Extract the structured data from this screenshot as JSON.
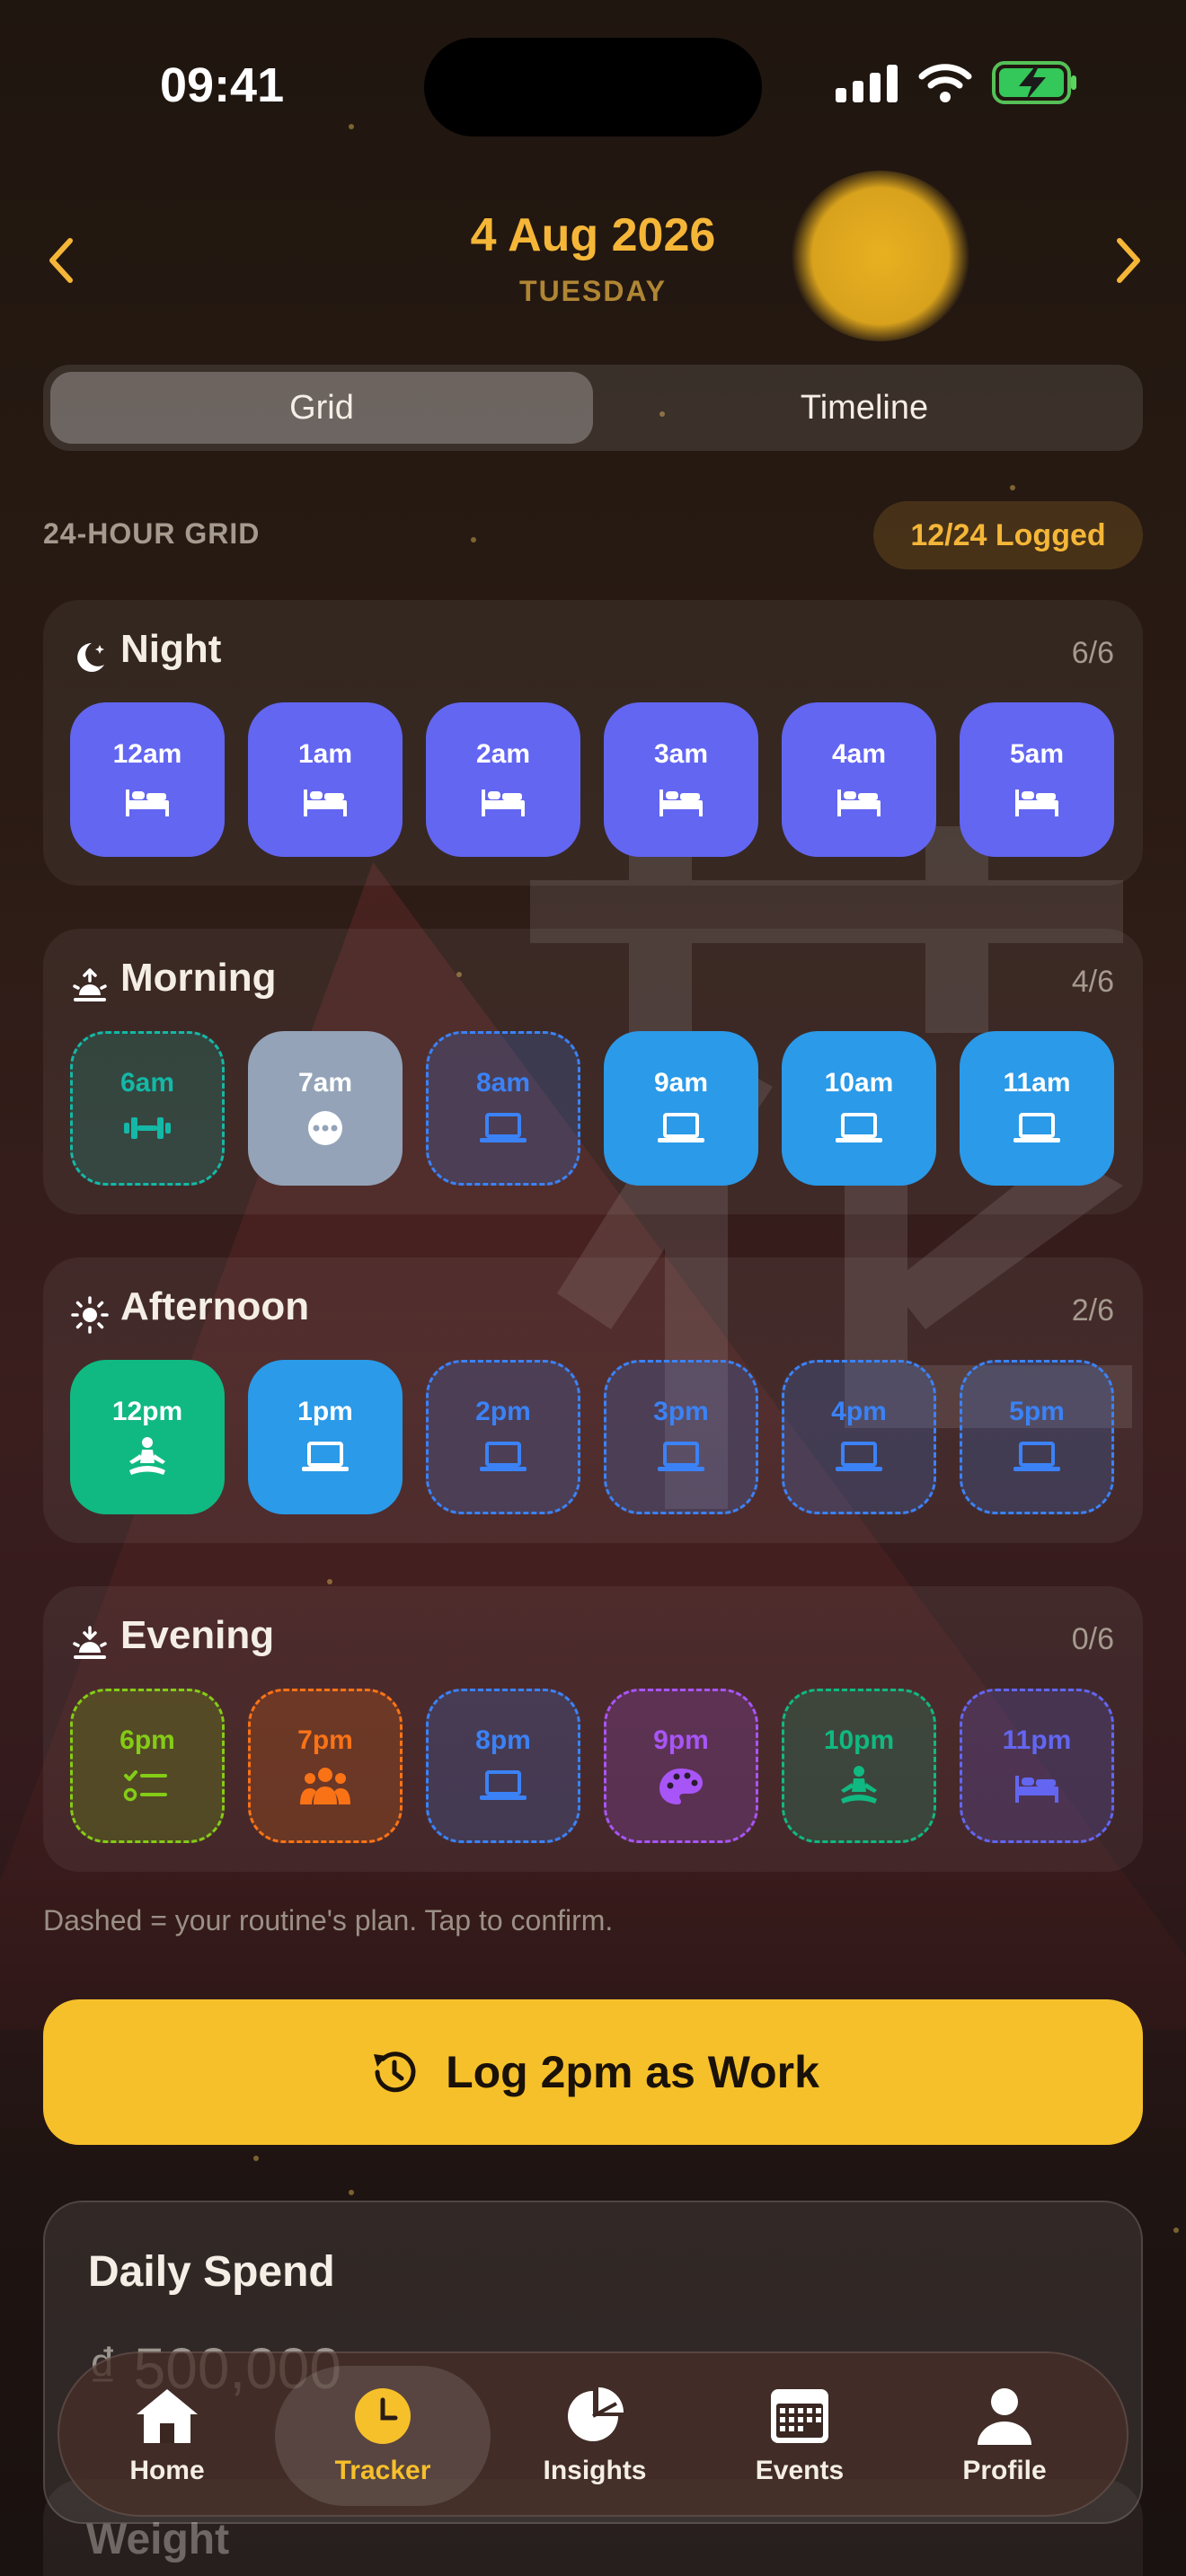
{
  "status_bar": {
    "time": "09:41"
  },
  "header": {
    "date": "4 Aug 2026",
    "weekday": "TUESDAY"
  },
  "view_toggle": {
    "options": [
      "Grid",
      "Timeline"
    ],
    "selected": "Grid"
  },
  "grid": {
    "heading": "24-HOUR GRID",
    "logged_badge": "12/24 Logged"
  },
  "sections": [
    {
      "title": "Night",
      "count": "6/6",
      "icon": "moon-icon",
      "slots": [
        {
          "label": "12am",
          "icon": "bed-icon",
          "state": "logged",
          "color": "#6366f1"
        },
        {
          "label": "1am",
          "icon": "bed-icon",
          "state": "logged",
          "color": "#6366f1"
        },
        {
          "label": "2am",
          "icon": "bed-icon",
          "state": "logged",
          "color": "#6366f1"
        },
        {
          "label": "3am",
          "icon": "bed-icon",
          "state": "logged",
          "color": "#6366f1"
        },
        {
          "label": "4am",
          "icon": "bed-icon",
          "state": "logged",
          "color": "#6366f1"
        },
        {
          "label": "5am",
          "icon": "bed-icon",
          "state": "logged",
          "color": "#6366f1"
        }
      ]
    },
    {
      "title": "Morning",
      "count": "4/6",
      "icon": "sunrise-icon",
      "slots": [
        {
          "label": "6am",
          "icon": "dumbbell-icon",
          "state": "planned",
          "color": "#14b8a6"
        },
        {
          "label": "7am",
          "icon": "more-icon",
          "state": "logged",
          "color": "#94a3b8"
        },
        {
          "label": "8am",
          "icon": "laptop-icon",
          "state": "planned",
          "color": "#3b82f6"
        },
        {
          "label": "9am",
          "icon": "laptop-icon",
          "state": "logged",
          "color": "#2b9ae8"
        },
        {
          "label": "10am",
          "icon": "laptop-icon",
          "state": "logged",
          "color": "#2b9ae8"
        },
        {
          "label": "11am",
          "icon": "laptop-icon",
          "state": "logged",
          "color": "#2b9ae8"
        }
      ]
    },
    {
      "title": "Afternoon",
      "count": "2/6",
      "icon": "sun-icon",
      "slots": [
        {
          "label": "12pm",
          "icon": "meditate-icon",
          "state": "logged",
          "color": "#10b981"
        },
        {
          "label": "1pm",
          "icon": "laptop-icon",
          "state": "logged",
          "color": "#2b9ae8"
        },
        {
          "label": "2pm",
          "icon": "laptop-icon",
          "state": "planned",
          "color": "#3b82f6"
        },
        {
          "label": "3pm",
          "icon": "laptop-icon",
          "state": "planned",
          "color": "#3b82f6"
        },
        {
          "label": "4pm",
          "icon": "laptop-icon",
          "state": "planned",
          "color": "#3b82f6"
        },
        {
          "label": "5pm",
          "icon": "laptop-icon",
          "state": "planned",
          "color": "#3b82f6"
        }
      ]
    },
    {
      "title": "Evening",
      "count": "0/6",
      "icon": "sunset-icon",
      "slots": [
        {
          "label": "6pm",
          "icon": "checklist-icon",
          "state": "planned",
          "color": "#84cc16"
        },
        {
          "label": "7pm",
          "icon": "people-icon",
          "state": "planned",
          "color": "#f97316"
        },
        {
          "label": "8pm",
          "icon": "laptop-icon",
          "state": "planned",
          "color": "#3b82f6"
        },
        {
          "label": "9pm",
          "icon": "palette-icon",
          "state": "planned",
          "color": "#a855f7"
        },
        {
          "label": "10pm",
          "icon": "meditate-icon",
          "state": "planned",
          "color": "#10b981"
        },
        {
          "label": "11pm",
          "icon": "bed-icon",
          "state": "planned",
          "color": "#6366f1"
        }
      ]
    }
  ],
  "note": "Dashed = your routine's plan. Tap to confirm.",
  "cta": {
    "label": "Log 2pm as Work",
    "icon": "history-icon"
  },
  "daily_spend": {
    "title": "Daily Spend",
    "value": "₫ 500,000"
  },
  "weight": {
    "title": "Weight"
  },
  "tabbar": {
    "items": [
      {
        "label": "Home",
        "icon": "home-icon"
      },
      {
        "label": "Tracker",
        "icon": "clock-icon"
      },
      {
        "label": "Insights",
        "icon": "pie-chart-icon"
      },
      {
        "label": "Events",
        "icon": "calendar-icon"
      },
      {
        "label": "Profile",
        "icon": "person-icon"
      }
    ],
    "selected": "Tracker"
  },
  "colors": {
    "accent": "#f6c02b",
    "date": "#f5b638"
  }
}
